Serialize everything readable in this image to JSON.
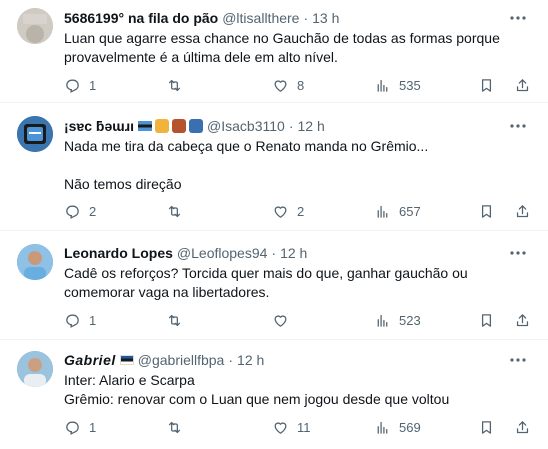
{
  "tweets": [
    {
      "name": "5686199° na fila do pão",
      "handle": "@ltisallthere",
      "time": "13 h",
      "lines": [
        "Luan que agarre essa chance no Gauchão de todas as formas porque",
        "provavelmente é a última dele em alto nível."
      ],
      "replies": "1",
      "retweets": "",
      "likes": "8",
      "views": "535",
      "avatar_color": "#c9c4bd"
    },
    {
      "name": "¡sɐc ƃǝɯɹı",
      "handle": "@Isacb3110",
      "time": "12 h",
      "lines": [
        "Nada me tira da cabeça que o Renato manda no Grêmio...",
        "Não temos direção"
      ],
      "replies": "2",
      "retweets": "",
      "likes": "2",
      "views": "657",
      "avatar_color": "#2f6fb0"
    },
    {
      "name": "Leonardo Lopes",
      "handle": "@Leoflopes94",
      "time": "12 h",
      "lines": [
        "Cadê os reforços? Torcida quer mais do que, ganhar gauchão ou",
        "comemorar vaga na libertadores."
      ],
      "replies": "1",
      "retweets": "",
      "likes": "",
      "views": "523",
      "avatar_color": "#5aa0d8"
    },
    {
      "name": "Gabriel",
      "handle": "@gabriellfbpa",
      "time": "12 h",
      "lines": [
        "Inter: Alario e Scarpa",
        "Grêmio: renovar com o Luan que nem jogou desde que voltou"
      ],
      "replies": "1",
      "retweets": "",
      "likes": "11",
      "views": "569",
      "avatar_color": "#7aa6c8"
    }
  ],
  "dot": "·",
  "colors": {
    "text": "#0f1419",
    "muted": "#536471",
    "divider": "#eff3f4"
  }
}
